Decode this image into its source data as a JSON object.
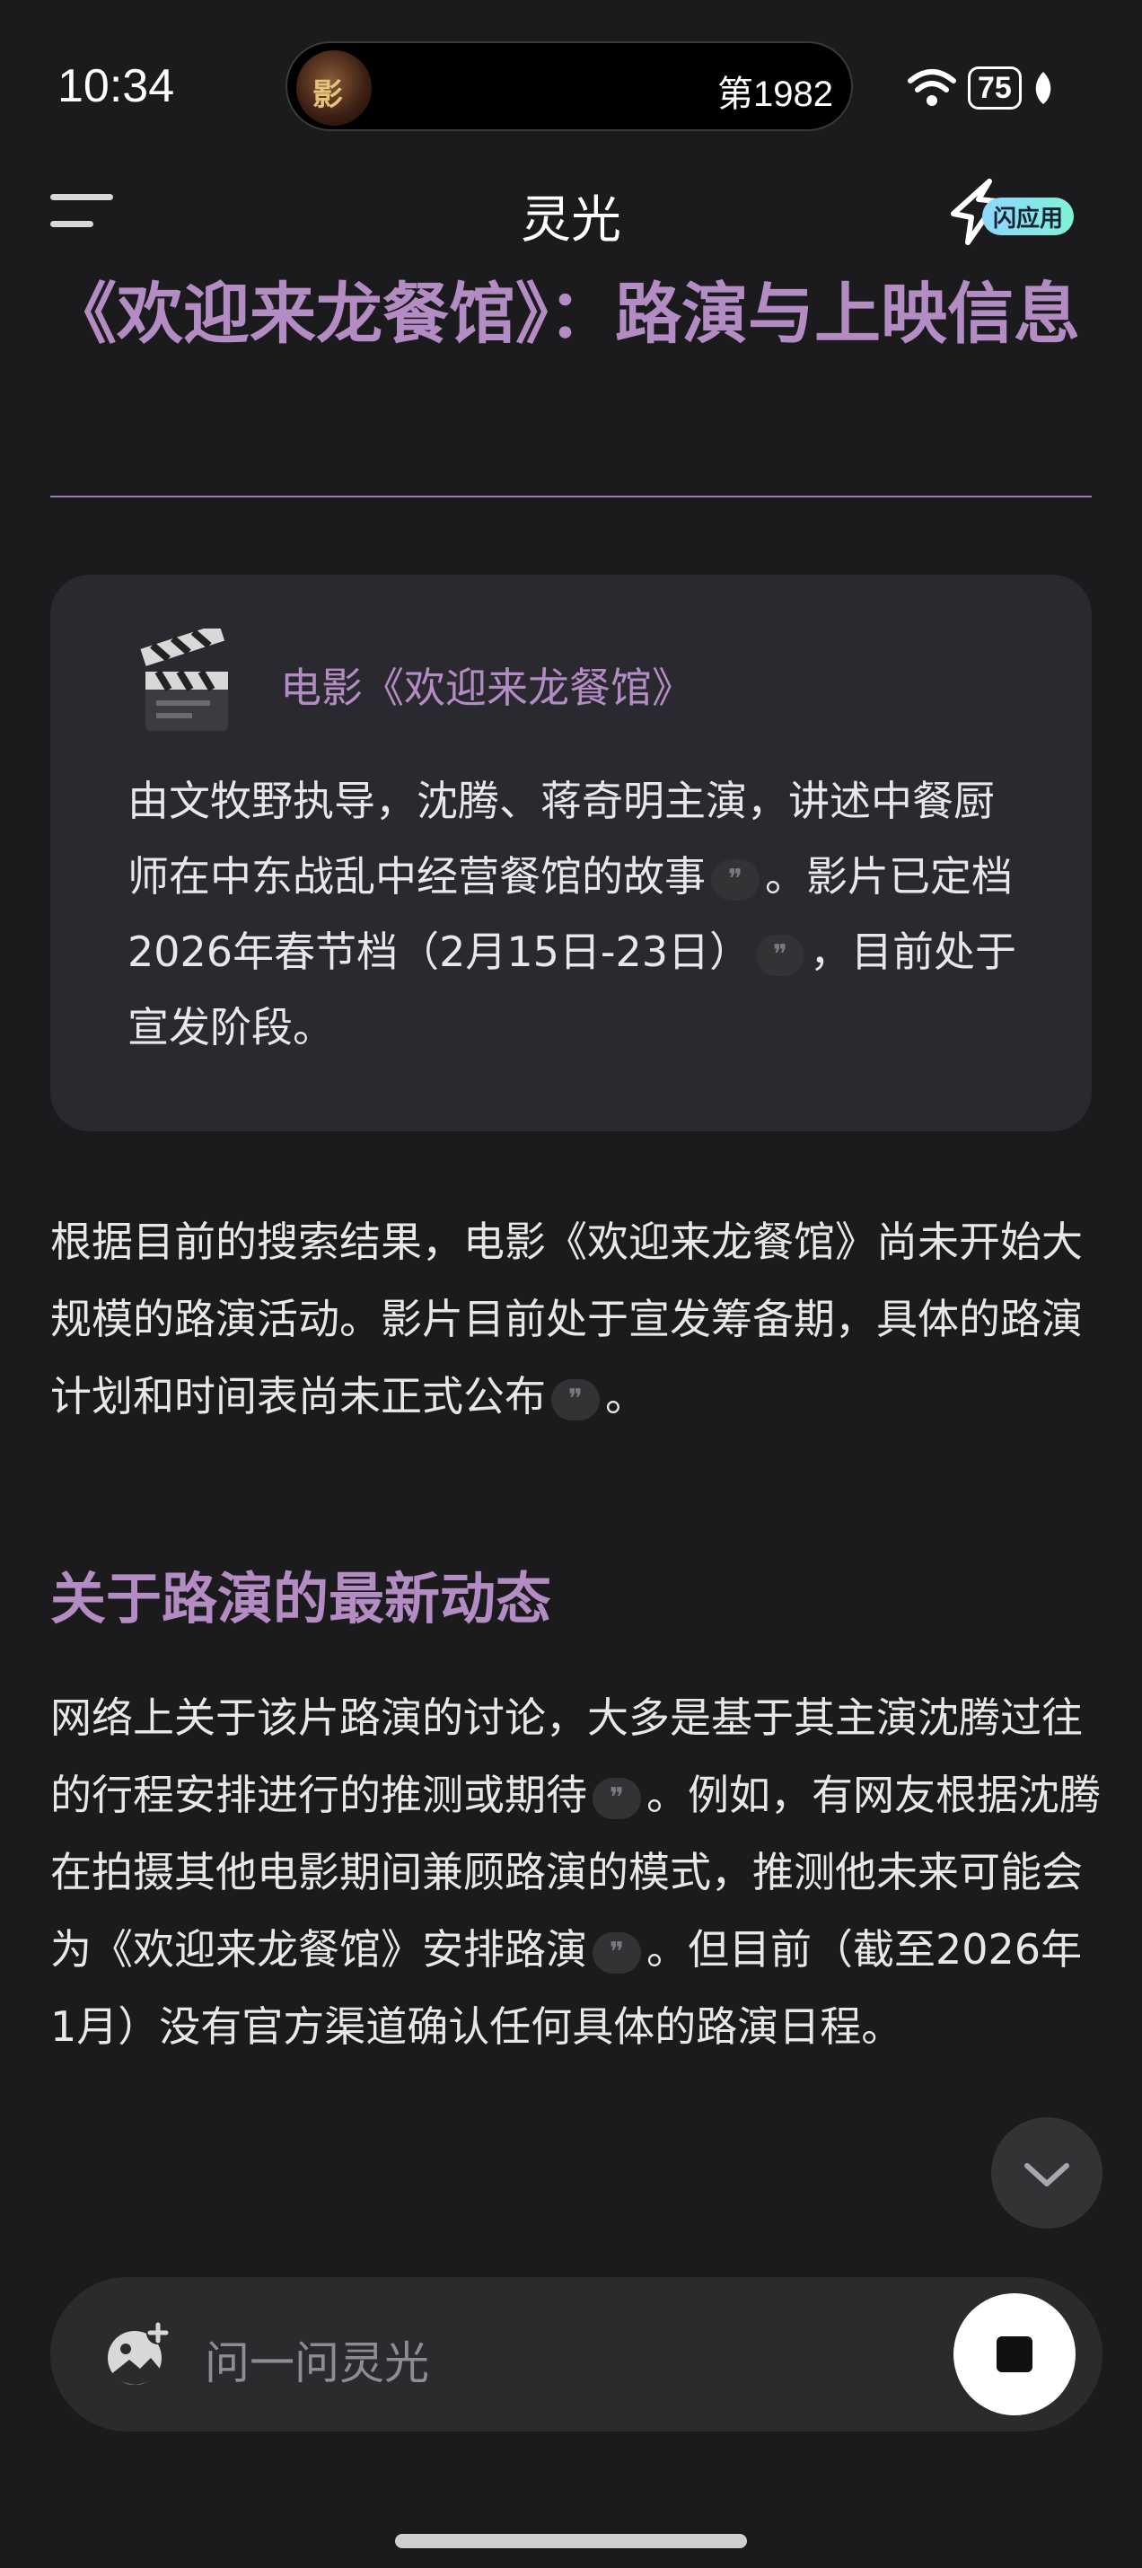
{
  "status_bar": {
    "time": "10:34",
    "island_text": "第1982",
    "island_thumb_char": "影",
    "battery": "75"
  },
  "header": {
    "title": "灵光",
    "flash_badge": "闪应用"
  },
  "article": {
    "heading": "《欢迎来龙餐馆》：路演与上映信息",
    "card": {
      "icon": "clapper-board-icon",
      "title": "电影《欢迎来龙餐馆》",
      "body_1": "由文牧野执导，沈腾、蒋奇明主演，讲述中餐厨师在中东战乱中经营餐馆的故事",
      "body_2": "。影片已定档2026年春节档（2月15日-23日）",
      "body_3": "，目前处于宣发阶段。"
    },
    "para1_a": "根据目前的搜索结果，电影《欢迎来龙餐馆》尚未开始大规模的路演活动。影片目前处于宣发筹备期，具体的路演计划和时间表尚未正式公布",
    "para1_b": "。",
    "section_heading": "关于路演的最新动态",
    "para2_a": "网络上关于该片路演的讨论，大多是基于其主演沈腾过往的行程安排进行的推测或期待",
    "para2_b": "。例如，有网友根据沈腾在拍摄其他电影期间兼顾路演的模式，推测他未来可能会为《欢迎来龙餐馆》安排路演",
    "para2_c": "。但目前（截至2026年1月）没有官方渠道确认任何具体的路演日程。"
  },
  "input": {
    "placeholder": "问一问灵光"
  },
  "colors": {
    "accent": "#b48cc4",
    "background": "#1b1b1d",
    "card": "#2b2930"
  }
}
